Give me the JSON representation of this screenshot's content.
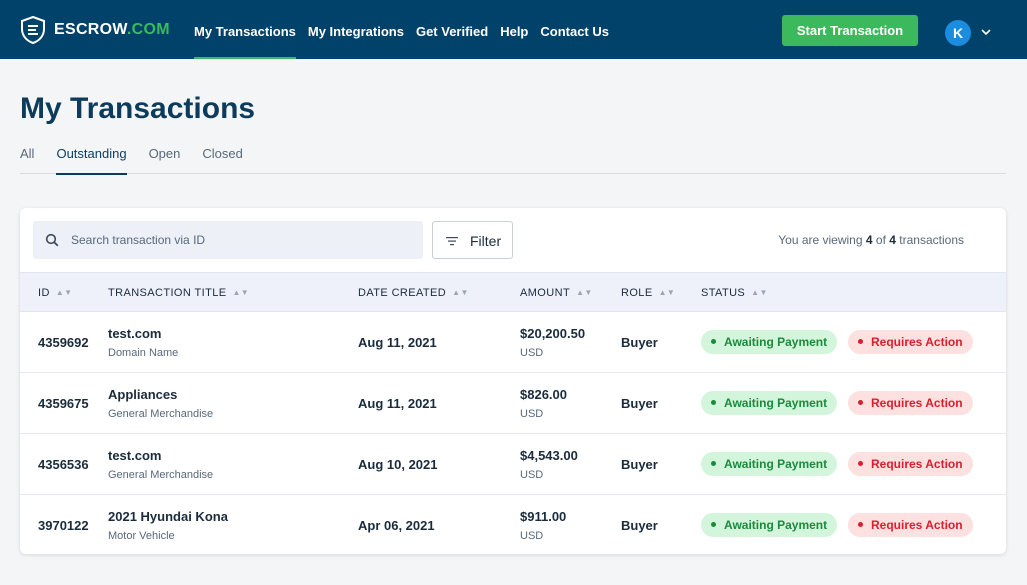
{
  "brand": {
    "name": "ESCROW",
    "suffix": ".COM",
    "accent": "#3cb95d",
    "navbar_color": "#01426a"
  },
  "nav": {
    "links": [
      {
        "label": "My Transactions",
        "active": true
      },
      {
        "label": "My Integrations"
      },
      {
        "label": "Get Verified"
      },
      {
        "label": "Help"
      },
      {
        "label": "Contact Us"
      }
    ],
    "start_button": "Start Transaction",
    "avatar_initial": "K"
  },
  "page": {
    "title": "My Transactions",
    "tabs": [
      {
        "label": "All"
      },
      {
        "label": "Outstanding",
        "active": true
      },
      {
        "label": "Open"
      },
      {
        "label": "Closed"
      }
    ]
  },
  "search": {
    "placeholder": "Search transaction via ID",
    "value": ""
  },
  "filter": {
    "label": "Filter"
  },
  "viewing": {
    "prefix": "You are viewing",
    "shown": "4",
    "of": "of",
    "total": "4",
    "suffix": "transactions"
  },
  "table": {
    "columns": [
      "ID",
      "TRANSACTION TITLE",
      "DATE CREATED",
      "AMOUNT",
      "ROLE",
      "STATUS"
    ],
    "rows": [
      {
        "id": "4359692",
        "title": "test.com",
        "category": "Domain Name",
        "date": "Aug 11, 2021",
        "amount": "$20,200.50",
        "currency": "USD",
        "role": "Buyer",
        "status1": "Awaiting Payment",
        "status2": "Requires Action"
      },
      {
        "id": "4359675",
        "title": "Appliances",
        "category": "General Merchandise",
        "date": "Aug 11, 2021",
        "amount": "$826.00",
        "currency": "USD",
        "role": "Buyer",
        "status1": "Awaiting Payment",
        "status2": "Requires Action"
      },
      {
        "id": "4356536",
        "title": "test.com",
        "category": "General Merchandise",
        "date": "Aug 10, 2021",
        "amount": "$4,543.00",
        "currency": "USD",
        "role": "Buyer",
        "status1": "Awaiting Payment",
        "status2": "Requires Action"
      },
      {
        "id": "3970122",
        "title": "2021 Hyundai Kona",
        "category": "Motor Vehicle",
        "date": "Apr 06, 2021",
        "amount": "$911.00",
        "currency": "USD",
        "role": "Buyer",
        "status1": "Awaiting Payment",
        "status2": "Requires Action"
      }
    ]
  }
}
